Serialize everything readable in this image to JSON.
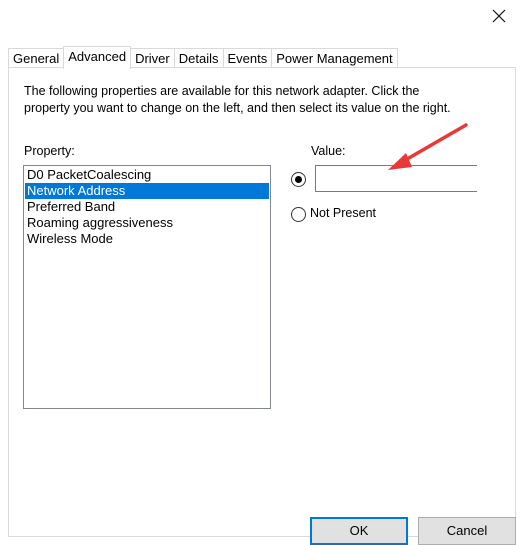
{
  "tabs": [
    {
      "label": "General"
    },
    {
      "label": "Advanced"
    },
    {
      "label": "Driver"
    },
    {
      "label": "Details"
    },
    {
      "label": "Events"
    },
    {
      "label": "Power Management"
    }
  ],
  "active_tab": "Advanced",
  "description": "The following properties are available for this network adapter. Click the property you want to change on the left, and then select its value on the right.",
  "property": {
    "label": "Property:",
    "items": [
      {
        "label": "D0 PacketCoalescing"
      },
      {
        "label": "Network Address"
      },
      {
        "label": "Preferred Band"
      },
      {
        "label": "Roaming aggressiveness"
      },
      {
        "label": "Wireless Mode"
      }
    ],
    "selected": "Network Address"
  },
  "value": {
    "label": "Value:",
    "input_value": "",
    "not_present_label": "Not Present",
    "selected_option": "value"
  },
  "buttons": {
    "ok": "OK",
    "cancel": "Cancel"
  },
  "colors": {
    "selection": "#0078d7",
    "annotation_arrow": "#e8393a"
  },
  "icons": {
    "close": "close-icon",
    "annotation": "arrow-icon"
  }
}
